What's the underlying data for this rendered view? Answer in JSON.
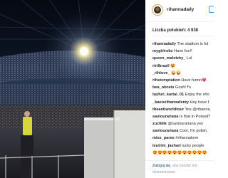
{
  "header": {
    "username": "rihannadaily"
  },
  "likes": {
    "text": "Liczba polubień: 4 938"
  },
  "comments": [
    {
      "user": "rihannadaily",
      "text": " The stadium is ful",
      "mention": false
    },
    {
      "user": "mygirlrobz",
      "text": " Have fun!!",
      "mention": false
    },
    {
      "user": "queen_maletzky_",
      "text": " Lol",
      "mention": false
    },
    {
      "user": "ririlbrazil",
      "text": " 😍",
      "mention": false
    },
    {
      "user": "_rihlove_",
      "text": " 😜😜",
      "mention": false
    },
    {
      "user": "rihstemptation",
      "text": " Have funnn💗",
      "mention": false
    },
    {
      "user": "bea_okneis",
      "text": " Gosh! f's",
      "mention": false
    },
    {
      "user": "tayfun_kartal_01",
      "text": " Enjoy the sho",
      "mention": false
    },
    {
      "user": "_baeisrihannafenty",
      "text": " Hey have f",
      "mention": false
    },
    {
      "user": "theantiworldtour",
      "text": " Yes @rihanna",
      "mention": true
    },
    {
      "user": "saviourariana",
      "text": " Is that in Poland?",
      "mention": false
    },
    {
      "user": "zuzliiiik",
      "text": " @saviourariana yes",
      "mention": true
    },
    {
      "user": "saviourariana",
      "text": " Cool. I'm polish.",
      "mention": false
    },
    {
      "user": "miss_pares",
      "text": " #rihannalove",
      "mention": true
    },
    {
      "user": "leutrim_jashari",
      "text": " lucky people",
      "mention": false
    },
    {
      "user": "",
      "text": "😍😍😍😍😍😍😍😍😍😍😍",
      "mention": false
    }
  ],
  "footer": {
    "login_link": "Zaloguj się",
    "login_rest": ", aby polubić lub",
    "login_line2": "skomentować."
  }
}
